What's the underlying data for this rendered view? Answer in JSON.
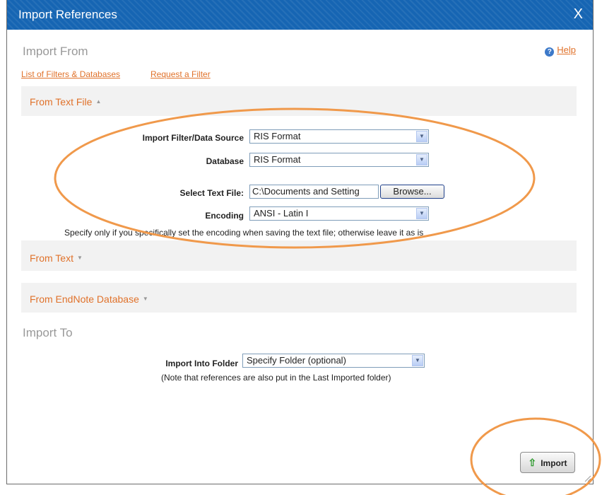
{
  "window": {
    "title": "Import References",
    "close_label": "X"
  },
  "import_from": {
    "heading": "Import From",
    "help_label": "Help",
    "links": [
      "List of Filters & Databases",
      "Request a Filter"
    ]
  },
  "text_file": {
    "header": "From Text File",
    "filter_label": "Import Filter/Data Source",
    "filter_value": "RIS Format",
    "database_label": "Database",
    "database_value": "RIS Format",
    "file_label": "Select Text File:",
    "file_value": "C:\\Documents and Setting",
    "browse_label": "Browse...",
    "encoding_label": "Encoding",
    "encoding_value": "ANSI - Latin I",
    "note": "Specify only if you specifically set the encoding when saving the text file; otherwise leave it as is"
  },
  "from_text": {
    "header": "From Text"
  },
  "from_endnote": {
    "header": "From EndNote Database"
  },
  "import_to": {
    "heading": "Import To",
    "folder_label": "Import Into Folder",
    "folder_value": "Specify Folder (optional)",
    "note": "(Note that references are also put in the Last Imported folder)"
  },
  "import_button": {
    "label": "Import"
  },
  "icons": {
    "help": "help-icon",
    "expand_up": "caret-up-icon",
    "expand_down": "caret-down-icon",
    "import": "up-arrow-icon"
  },
  "colors": {
    "title_bar": "#1665b3",
    "link": "#e0722b",
    "annotation": "#f0994b",
    "panel": "#f2f2f2"
  }
}
